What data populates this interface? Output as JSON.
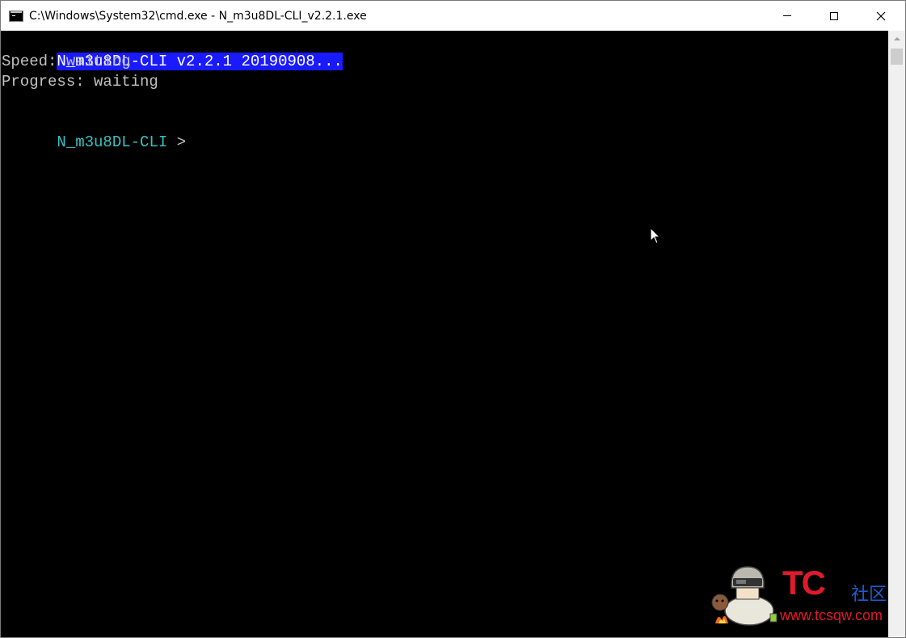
{
  "window": {
    "title": "C:\\Windows\\System32\\cmd.exe - N_m3u8DL-CLI_v2.2.1.exe",
    "controls": {
      "minimize": "minimize",
      "maximize": "maximize",
      "close": "✕"
    }
  },
  "console": {
    "header_line": "N_m3u8DL-CLI v2.2.1 20190908...",
    "speed_line": "Speed: waiting",
    "progress_line": "Progress: waiting",
    "prompt_name": "N_m3u8DL-CLI",
    "prompt_symbol": " >"
  },
  "watermark": {
    "brand": "TC",
    "community": "社区",
    "url": "www.tcsqw.com"
  },
  "colors": {
    "console_bg": "#000000",
    "console_text": "#c0c0c0",
    "selection_bg": "#1a1aff",
    "prompt_color": "#3ac0c0",
    "watermark_red": "#e01a2b",
    "watermark_blue": "#1a5fd1"
  },
  "icons": {
    "app_icon": "cmd-console-icon",
    "cursor": "mouse-pointer-icon",
    "mascot": "helmet-mascot-icon"
  }
}
